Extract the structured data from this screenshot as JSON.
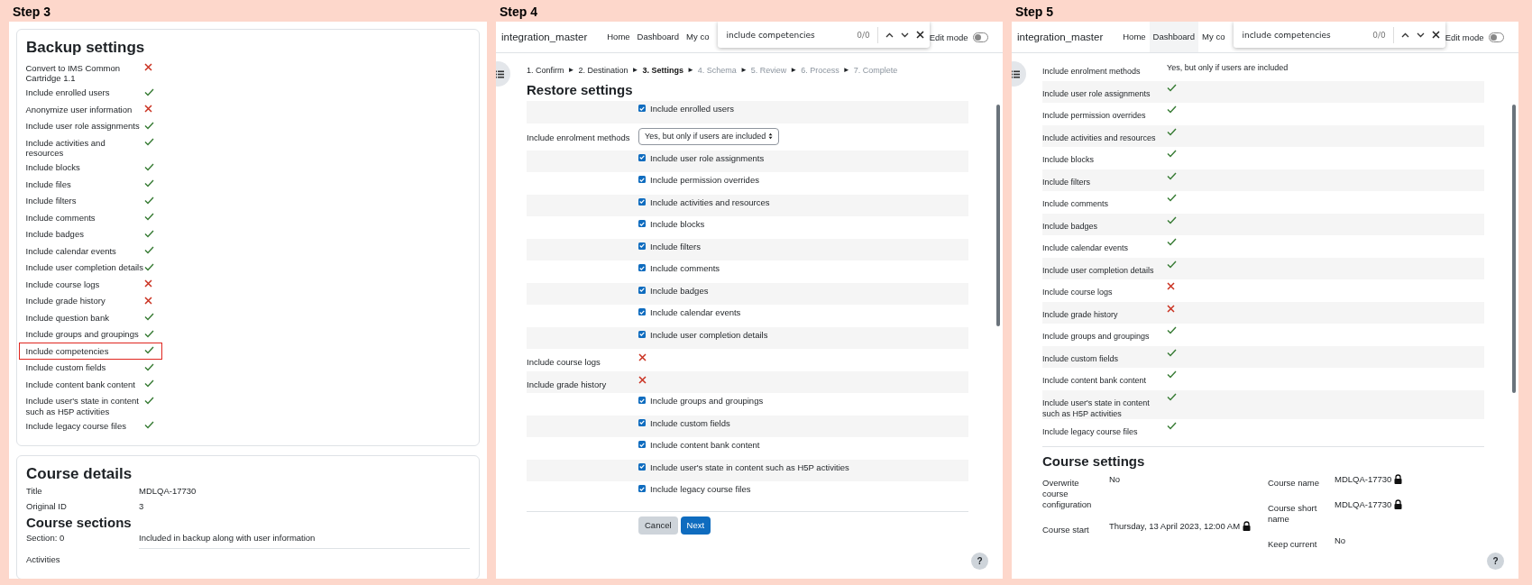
{
  "step3": {
    "label": "Step 3",
    "backup_settings": {
      "title": "Backup settings",
      "rows": [
        {
          "label": "Convert to IMS Common Cartridge 1.1",
          "included": false,
          "highlighted": false
        },
        {
          "label": "Include enrolled users",
          "included": true,
          "highlighted": false
        },
        {
          "label": "Anonymize user information",
          "included": false,
          "highlighted": false
        },
        {
          "label": "Include user role assignments",
          "included": true,
          "highlighted": false
        },
        {
          "label": "Include activities and resources",
          "included": true,
          "highlighted": false
        },
        {
          "label": "Include blocks",
          "included": true,
          "highlighted": false
        },
        {
          "label": "Include files",
          "included": true,
          "highlighted": false
        },
        {
          "label": "Include filters",
          "included": true,
          "highlighted": false
        },
        {
          "label": "Include comments",
          "included": true,
          "highlighted": false
        },
        {
          "label": "Include badges",
          "included": true,
          "highlighted": false
        },
        {
          "label": "Include calendar events",
          "included": true,
          "highlighted": false
        },
        {
          "label": "Include user completion details",
          "included": true,
          "highlighted": false
        },
        {
          "label": "Include course logs",
          "included": false,
          "highlighted": false
        },
        {
          "label": "Include grade history",
          "included": false,
          "highlighted": false
        },
        {
          "label": "Include question bank",
          "included": true,
          "highlighted": false
        },
        {
          "label": "Include groups and groupings",
          "included": true,
          "highlighted": false
        },
        {
          "label": "Include competencies",
          "included": true,
          "highlighted": true
        },
        {
          "label": "Include custom fields",
          "included": true,
          "highlighted": false
        },
        {
          "label": "Include content bank content",
          "included": true,
          "highlighted": false
        },
        {
          "label": "Include user's state in content such as H5P activities",
          "included": true,
          "highlighted": false
        },
        {
          "label": "Include legacy course files",
          "included": true,
          "highlighted": false
        }
      ]
    },
    "course_details": {
      "title": "Course details",
      "rows": [
        {
          "label": "Title",
          "value": "MDLQA-17730"
        },
        {
          "label": "Original ID",
          "value": "3"
        }
      ]
    },
    "course_sections": {
      "title": "Course sections",
      "rows": [
        {
          "label": "Section: 0",
          "value": "Included in backup along with user information"
        },
        {
          "label": "Activities"
        }
      ]
    }
  },
  "step4": {
    "label": "Step 4",
    "navbar": {
      "brand": "integration_master",
      "links": [
        {
          "label": "Home",
          "hovered": false
        },
        {
          "label": "Dashboard",
          "hovered": false
        },
        {
          "label": "My co",
          "hovered": false
        }
      ],
      "find_bar": {
        "query": "include competencies",
        "count": "0/0"
      },
      "edit_mode": {
        "label": "Edit mode",
        "on": false
      }
    },
    "breadcrumb": {
      "separator": "►",
      "steps": [
        {
          "label": "1. Confirm",
          "selected": false,
          "completed": true
        },
        {
          "label": "2. Destination",
          "selected": false,
          "completed": true
        },
        {
          "label": "3. Settings",
          "selected": true,
          "completed": false
        },
        {
          "label": "4. Schema",
          "selected": false,
          "completed": false
        },
        {
          "label": "5. Review",
          "selected": false,
          "completed": false
        },
        {
          "label": "6. Process",
          "selected": false,
          "completed": false
        },
        {
          "label": "7. Complete",
          "selected": false,
          "completed": false
        }
      ]
    },
    "title": "Restore settings",
    "rows": [
      {
        "kind": "checkbox",
        "label": "Include enrolled users",
        "checked": true
      },
      {
        "kind": "select",
        "label": "Include enrolment methods",
        "value": "Yes, but only if users are included"
      },
      {
        "kind": "checkbox",
        "label": "Include user role assignments",
        "checked": true
      },
      {
        "kind": "checkbox",
        "label": "Include permission overrides",
        "checked": true
      },
      {
        "kind": "checkbox",
        "label": "Include activities and resources",
        "checked": true
      },
      {
        "kind": "checkbox",
        "label": "Include blocks",
        "checked": true
      },
      {
        "kind": "checkbox",
        "label": "Include filters",
        "checked": true
      },
      {
        "kind": "checkbox",
        "label": "Include comments",
        "checked": true
      },
      {
        "kind": "checkbox",
        "label": "Include badges",
        "checked": true
      },
      {
        "kind": "checkbox",
        "label": "Include calendar events",
        "checked": true
      },
      {
        "kind": "checkbox",
        "label": "Include user completion details",
        "checked": true
      },
      {
        "kind": "flag",
        "label": "Include course logs",
        "included": false
      },
      {
        "kind": "flag",
        "label": "Include grade history",
        "included": false
      },
      {
        "kind": "checkbox",
        "label": "Include groups and groupings",
        "checked": true
      },
      {
        "kind": "checkbox",
        "label": "Include custom fields",
        "checked": true
      },
      {
        "kind": "checkbox",
        "label": "Include content bank content",
        "checked": true
      },
      {
        "kind": "checkbox",
        "label": "Include user's state in content such as H5P activities",
        "checked": true
      },
      {
        "kind": "checkbox",
        "label": "Include legacy course files",
        "checked": true
      }
    ],
    "buttons": [
      {
        "label": "Cancel",
        "primary": false
      },
      {
        "label": "Next",
        "primary": true
      }
    ],
    "help": "?"
  },
  "step5": {
    "label": "Step 5",
    "navbar": {
      "brand": "integration_master",
      "links": [
        {
          "label": "Home",
          "hovered": false
        },
        {
          "label": "Dashboard",
          "hovered": true
        },
        {
          "label": "My co",
          "hovered": false
        }
      ],
      "find_bar": {
        "query": "include competencies",
        "count": "0/0"
      },
      "edit_mode": {
        "label": "Edit mode",
        "on": false
      }
    },
    "rows": [
      {
        "kind": "text",
        "label": "Include enrolment methods",
        "value": "Yes, but only if users are included"
      },
      {
        "kind": "flag",
        "label": "Include user role assignments",
        "included": true
      },
      {
        "kind": "flag",
        "label": "Include permission overrides",
        "included": true
      },
      {
        "kind": "flag",
        "label": "Include activities and resources",
        "included": true
      },
      {
        "kind": "flag",
        "label": "Include blocks",
        "included": true
      },
      {
        "kind": "flag",
        "label": "Include filters",
        "included": true
      },
      {
        "kind": "flag",
        "label": "Include comments",
        "included": true
      },
      {
        "kind": "flag",
        "label": "Include badges",
        "included": true
      },
      {
        "kind": "flag",
        "label": "Include calendar events",
        "included": true
      },
      {
        "kind": "flag",
        "label": "Include user completion details",
        "included": true
      },
      {
        "kind": "flag",
        "label": "Include course logs",
        "included": false
      },
      {
        "kind": "flag",
        "label": "Include grade history",
        "included": false
      },
      {
        "kind": "flag",
        "label": "Include groups and groupings",
        "included": true
      },
      {
        "kind": "flag",
        "label": "Include custom fields",
        "included": true
      },
      {
        "kind": "flag",
        "label": "Include content bank content",
        "included": true
      },
      {
        "kind": "flag",
        "label": "Include user's state in content such as H5P activities",
        "included": true
      },
      {
        "kind": "flag",
        "label": "Include legacy course files",
        "included": true
      }
    ],
    "course_settings": {
      "title": "Course settings",
      "left_fields": [
        {
          "label": "Overwrite course configuration",
          "value": "No",
          "locked": false
        },
        {
          "label": "Course start",
          "value": "Thursday, 13 April 2023, 12:00 AM",
          "locked": true
        }
      ],
      "right_fields": [
        {
          "label": "Course name",
          "value": "MDLQA-17730",
          "locked": true
        },
        {
          "label": "Course short name",
          "value": "MDLQA-17730",
          "locked": true
        },
        {
          "label": "Keep current",
          "value": "No",
          "locked": false
        }
      ]
    },
    "help": "?"
  }
}
